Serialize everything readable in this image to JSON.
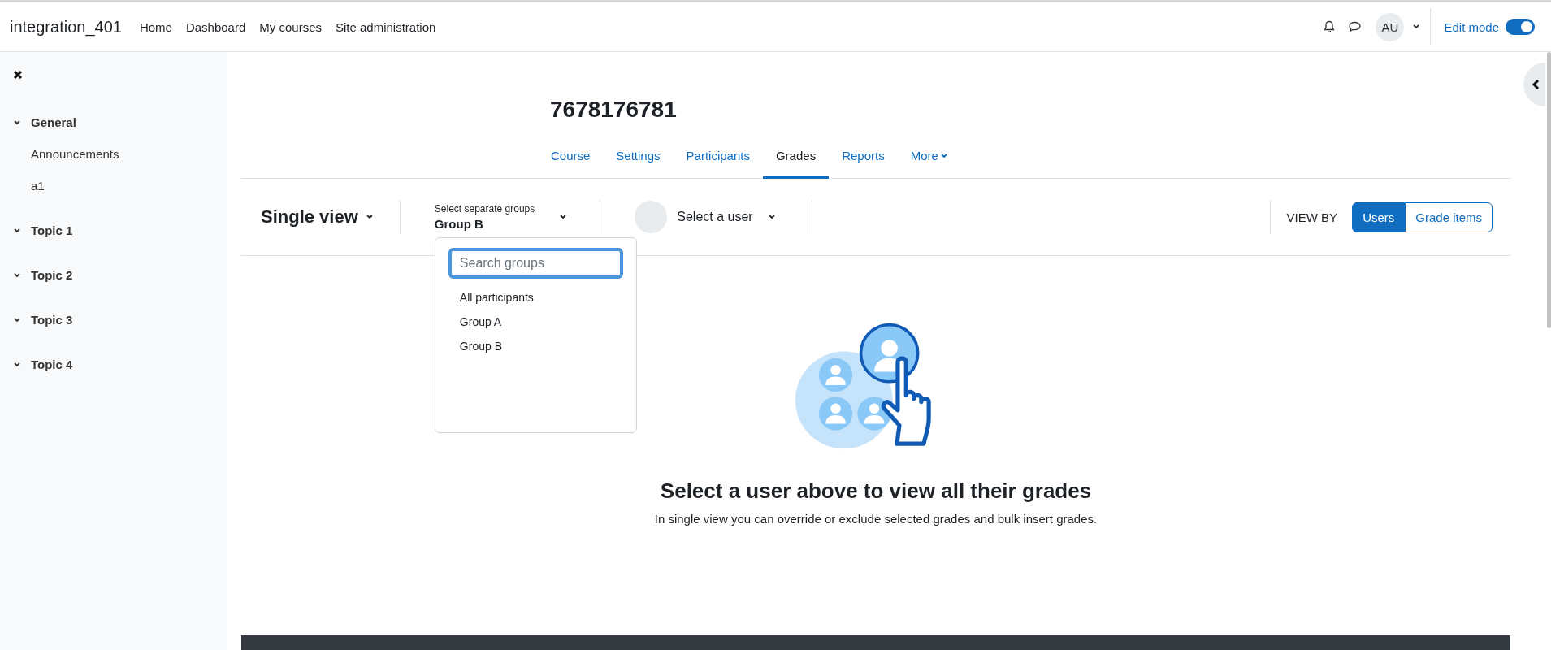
{
  "navbar": {
    "brand": "integration_401",
    "links": [
      {
        "label": "Home"
      },
      {
        "label": "Dashboard"
      },
      {
        "label": "My courses"
      },
      {
        "label": "Site administration"
      }
    ],
    "avatar": "AU",
    "edit_mode": {
      "label": "Edit mode",
      "on": true
    }
  },
  "sidebar": {
    "items": [
      {
        "label": "General",
        "expanded": true,
        "children": [
          {
            "label": "Announcements"
          },
          {
            "label": "a1"
          }
        ]
      },
      {
        "label": "Topic 1",
        "expanded": true
      },
      {
        "label": "Topic 2",
        "expanded": true
      },
      {
        "label": "Topic 3",
        "expanded": true
      },
      {
        "label": "Topic 4",
        "expanded": true
      }
    ]
  },
  "course_title": "7678176781",
  "tabs": [
    {
      "label": "Course",
      "selected": false
    },
    {
      "label": "Settings",
      "selected": false
    },
    {
      "label": "Participants",
      "selected": false
    },
    {
      "label": "Grades",
      "selected": true
    },
    {
      "label": "Reports",
      "selected": false
    },
    {
      "label": "More",
      "selected": false,
      "kind": "menu"
    }
  ],
  "toolbar": {
    "report": "Single view",
    "group_label": "Select separate groups",
    "group_value": "Group B",
    "user_select": "Select a user",
    "view_by": "VIEW BY",
    "view_buttons": [
      {
        "label": "Users",
        "selected": true
      },
      {
        "label": "Grade items",
        "selected": false
      }
    ]
  },
  "group_dropdown": {
    "search": {
      "placeholder": "Search groups"
    },
    "options": [
      {
        "label": "All participants"
      },
      {
        "label": "Group A"
      },
      {
        "label": "Group B"
      }
    ]
  },
  "empty_state": {
    "heading": "Select a user above to view all their grades",
    "text": "In single view you can override or exclude selected grades and bulk insert grades."
  }
}
